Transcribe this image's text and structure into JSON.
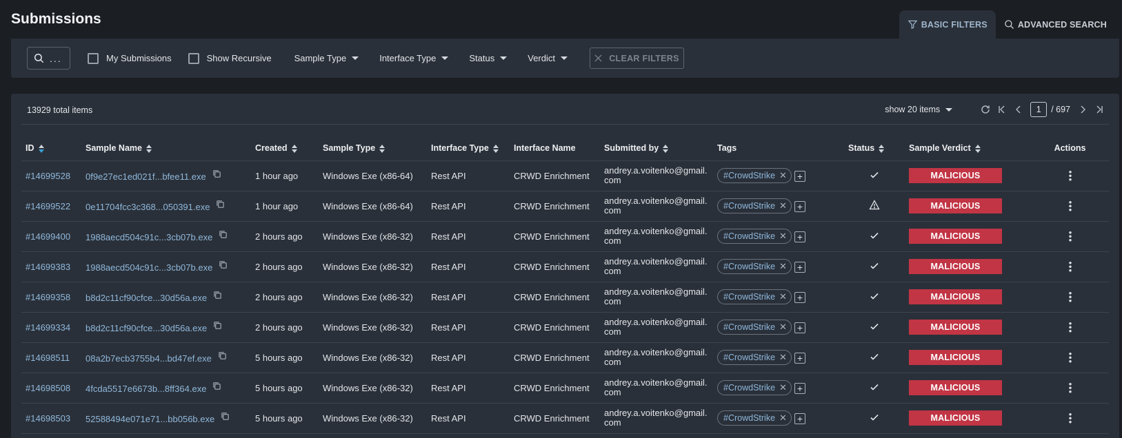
{
  "header": {
    "title": "Submissions",
    "tabs": [
      {
        "label": "BASIC FILTERS",
        "icon": "filter-icon",
        "active": true
      },
      {
        "label": "ADVANCED SEARCH",
        "icon": "search-icon",
        "active": false
      }
    ]
  },
  "filters": {
    "search_placeholder": "...",
    "my_submissions": "My Submissions",
    "show_recursive": "Show Recursive",
    "sample_type": "Sample Type",
    "interface_type": "Interface Type",
    "status": "Status",
    "verdict": "Verdict",
    "clear": "CLEAR FILTERS"
  },
  "toolbar": {
    "total": "13929 total items",
    "page_size": "show 20 items",
    "page": "1",
    "page_total": "/ 697"
  },
  "columns": [
    "ID",
    "Sample Name",
    "Created",
    "Sample Type",
    "Interface Type",
    "Interface Name",
    "Submitted by",
    "Tags",
    "Status",
    "Sample Verdict",
    "Actions"
  ],
  "rows": [
    {
      "id": "#14699528",
      "name": "0f9e27ec1ed021f...bfee11.exe",
      "created": "1 hour ago",
      "type": "Windows Exe (x86-64)",
      "iface_type": "Rest API",
      "iface_name": "CRWD Enrichment",
      "by": "andrey.a.voitenko@gmail.com",
      "tag": "#CrowdStrike",
      "status": "check",
      "verdict": "MALICIOUS"
    },
    {
      "id": "#14699522",
      "name": "0e11704fcc3c368...050391.exe",
      "created": "1 hour ago",
      "type": "Windows Exe (x86-64)",
      "iface_type": "Rest API",
      "iface_name": "CRWD Enrichment",
      "by": "andrey.a.voitenko@gmail.com",
      "tag": "#CrowdStrike",
      "status": "warning",
      "verdict": "MALICIOUS"
    },
    {
      "id": "#14699400",
      "name": "1988aecd504c91c...3cb07b.exe",
      "created": "2 hours ago",
      "type": "Windows Exe (x86-32)",
      "iface_type": "Rest API",
      "iface_name": "CRWD Enrichment",
      "by": "andrey.a.voitenko@gmail.com",
      "tag": "#CrowdStrike",
      "status": "check",
      "verdict": "MALICIOUS"
    },
    {
      "id": "#14699383",
      "name": "1988aecd504c91c...3cb07b.exe",
      "created": "2 hours ago",
      "type": "Windows Exe (x86-32)",
      "iface_type": "Rest API",
      "iface_name": "CRWD Enrichment",
      "by": "andrey.a.voitenko@gmail.com",
      "tag": "#CrowdStrike",
      "status": "check",
      "verdict": "MALICIOUS"
    },
    {
      "id": "#14699358",
      "name": "b8d2c11cf90cfce...30d56a.exe",
      "created": "2 hours ago",
      "type": "Windows Exe (x86-32)",
      "iface_type": "Rest API",
      "iface_name": "CRWD Enrichment",
      "by": "andrey.a.voitenko@gmail.com",
      "tag": "#CrowdStrike",
      "status": "check",
      "verdict": "MALICIOUS"
    },
    {
      "id": "#14699334",
      "name": "b8d2c11cf90cfce...30d56a.exe",
      "created": "2 hours ago",
      "type": "Windows Exe (x86-32)",
      "iface_type": "Rest API",
      "iface_name": "CRWD Enrichment",
      "by": "andrey.a.voitenko@gmail.com",
      "tag": "#CrowdStrike",
      "status": "check",
      "verdict": "MALICIOUS"
    },
    {
      "id": "#14698511",
      "name": "08a2b7ecb3755b4...bd47ef.exe",
      "created": "5 hours ago",
      "type": "Windows Exe (x86-32)",
      "iface_type": "Rest API",
      "iface_name": "CRWD Enrichment",
      "by": "andrey.a.voitenko@gmail.com",
      "tag": "#CrowdStrike",
      "status": "check",
      "verdict": "MALICIOUS"
    },
    {
      "id": "#14698508",
      "name": "4fcda5517e6673b...8ff364.exe",
      "created": "5 hours ago",
      "type": "Windows Exe (x86-32)",
      "iface_type": "Rest API",
      "iface_name": "CRWD Enrichment",
      "by": "andrey.a.voitenko@gmail.com",
      "tag": "#CrowdStrike",
      "status": "check",
      "verdict": "MALICIOUS"
    },
    {
      "id": "#14698503",
      "name": "52588494e071e71...bb056b.exe",
      "created": "5 hours ago",
      "type": "Windows Exe (x86-32)",
      "iface_type": "Rest API",
      "iface_name": "CRWD Enrichment",
      "by": "andrey.a.voitenko@gmail.com",
      "tag": "#CrowdStrike",
      "status": "check",
      "verdict": "MALICIOUS"
    }
  ],
  "colors": {
    "background": "#1b1e23",
    "panel": "#2a3039",
    "link": "#8fb8dc",
    "malicious": "#c13545",
    "sort_active": "#3aa1d8"
  }
}
